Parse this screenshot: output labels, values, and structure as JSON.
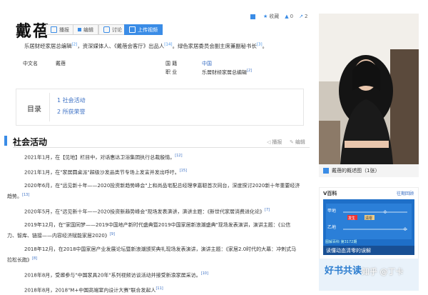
{
  "page": {
    "title": "戴蓓",
    "actions": {
      "play": "播报",
      "edit": "编辑",
      "discuss": "讨论",
      "upload": "上传视频"
    },
    "top": {
      "fav": "收藏",
      "likes": "0",
      "shares": "2"
    }
  },
  "summary": {
    "t1": "乐居财经家居总编辑",
    "r1": "[2]",
    "t2": "，资深媒体人、《戴蓓会客厅》出品人",
    "r2": "[14]",
    "t3": "。绿色家居委员会副主席兼副秘书长",
    "r3": "[3]",
    "t4": "。"
  },
  "info": {
    "name_key": "中文名",
    "name_val": "戴蓓",
    "nat_key": "国    籍",
    "nat_val": "中国",
    "job_key": "职    业",
    "job_val": "乐居财经家居总编辑",
    "job_ref": "[2]"
  },
  "toc": {
    "title": "目录",
    "items": [
      "1  社会活动",
      "2  所获荣誉"
    ]
  },
  "section": {
    "title": "社会活动",
    "play": "播报",
    "edit": "编辑"
  },
  "paras": [
    {
      "lines": [
        "2021年1月，在【见地】栏目中，对话惠达卫浴集团执行总裁殷情。"
      ],
      "ref": "[12]"
    },
    {
      "lines": [
        "2021年1月，在\"家居圆桌派\"超级沙发品类节专场上发言并发出呼吁。"
      ],
      "ref": "[15]"
    },
    {
      "lines": [
        "2020年6月，在\"远见新十年——2020投资新趋势峰会\"上和尚品宅配总经理李嘉聪首次同台，深度探讨2020新十年重要经济",
        "趋势。"
      ],
      "ref": "[13]"
    },
    {
      "lines": [
        "2020年5月，在\"远见新十年——2020投资新趋势峰会\"现场发表演讲，演讲主题：《新世代家居消费进化论》"
      ],
      "ref": "[7]"
    },
    {
      "lines": [
        "2019年12月，在\"家国同梦——2019中国地产新时代盛典暨2019中国家居新浪潮盛典\"现场发表演讲，演讲主题：《公信",
        "力、智库、链接——内容经济赋能家居2020》"
      ],
      "ref": "[9]"
    },
    {
      "lines": [
        "2018年12月，在2018中国家居产业发展论坛暨新浪潮颁奖典礼现场发表演讲，演讲主题：《家居2.0时代的大幕：冲刺式马",
        "拉松长跑》"
      ],
      "ref": "[8]"
    },
    {
      "lines": [
        "2018年8月，受邀参与\"中国家具20年\"系列视频访谈活动并接受新浪家居采访。"
      ],
      "ref": "[10]"
    },
    {
      "lines": [
        "2018年8月，2018\"M+中国高端室内设计大赛\"联合发起人"
      ],
      "ref": "[11]"
    }
  ],
  "sidebar": {
    "caption": "戴蓓的概述图（1张）",
    "vbaike_head": "V百科",
    "vbaike_more": "往期回顾",
    "vbaike_cap": "读懂动态清零的误解",
    "vbaike_issue": "第3172期",
    "vbaike_label": "图解百科",
    "vb_a": "甲地",
    "vb_b": "乙地",
    "vb_c1": "发生",
    "vb_c2": "清零",
    "vb_c3": "0",
    "vb_c4": "0",
    "promo": "好书共读",
    "watermark": "知乎 @丁卡"
  },
  "colors": {
    "accent": "#3a8ce6",
    "link": "#3a6fc4"
  }
}
